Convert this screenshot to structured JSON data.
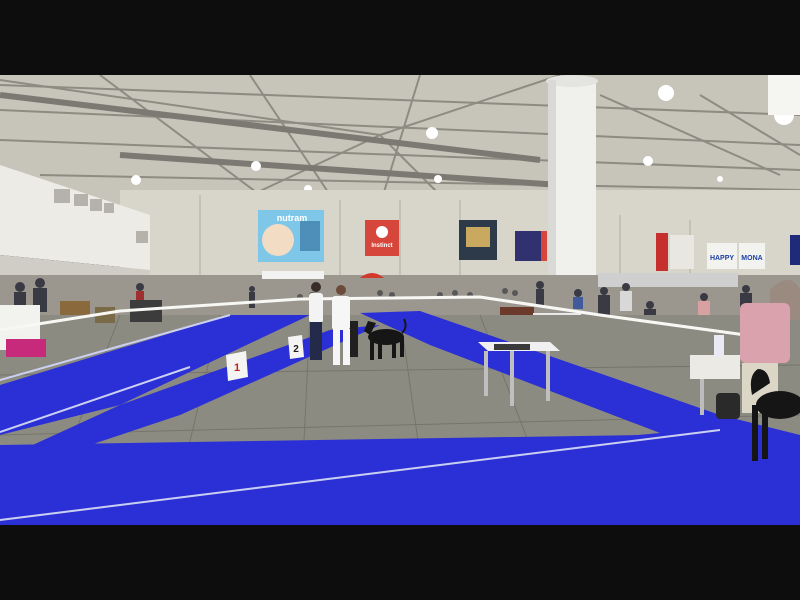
{
  "scene": {
    "signs": {
      "banner_left": "nutram",
      "banner_center": "Instinct",
      "banner_right_a": "HAPPY",
      "banner_right_b": "MONA",
      "number_card_1": "1",
      "number_card_2": "2"
    },
    "colors": {
      "floor_grey": "#8a8a80",
      "carpet_blue": "#2b2fd6",
      "wall": "#d9d6cc",
      "ceiling": "#c9c6bc",
      "pillar": "#f1f1ee"
    }
  }
}
